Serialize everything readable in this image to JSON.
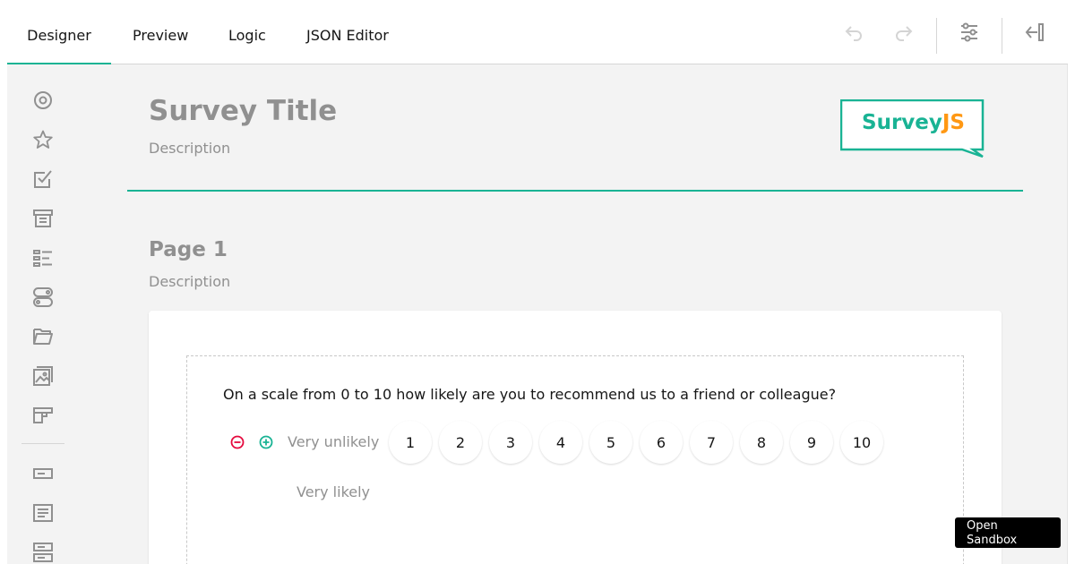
{
  "tabs": {
    "designer": "Designer",
    "preview": "Preview",
    "logic": "Logic",
    "json_editor": "JSON Editor"
  },
  "toolbar_icons": [
    "undo-icon",
    "redo-icon",
    "settings-icon",
    "collapse-panel-icon"
  ],
  "toolbox_icons": [
    "radiogroup-icon",
    "rating-icon",
    "checkbox-icon",
    "dropdown-icon",
    "ranking-icon",
    "boolean-icon",
    "file-icon",
    "image-picker-icon",
    "matrix-icon",
    "text-icon",
    "comment-icon",
    "multiple-text-icon"
  ],
  "survey": {
    "title": "Survey Title",
    "description": "Description",
    "logo_text_main": "Survey",
    "logo_text_accent": "JS"
  },
  "page": {
    "title": "Page 1",
    "description": "Description"
  },
  "question": {
    "title": "On a scale from 0 to 10 how likely are you to recommend us to a friend or colleague?",
    "min_label": "Very unlikely",
    "max_label": "Very likely",
    "rates": [
      "1",
      "2",
      "3",
      "4",
      "5",
      "6",
      "7",
      "8",
      "9",
      "10"
    ]
  },
  "sandbox_label": "Open Sandbox",
  "colors": {
    "accent": "#19b394",
    "remove": "#e50a3e",
    "logo_accent": "#ff9814"
  }
}
